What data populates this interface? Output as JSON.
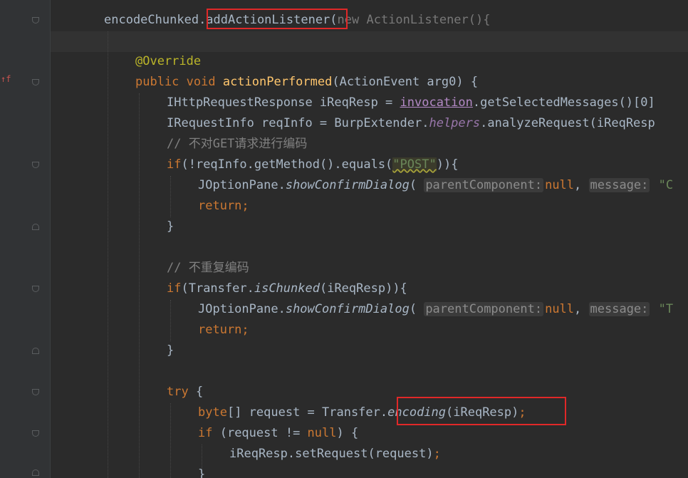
{
  "editor": {
    "lines": [
      [
        {
          "t": "encodeChunked",
          "c": "plain"
        },
        {
          "t": ".addActionListener",
          "c": "plain"
        },
        {
          "t": "(",
          "c": "plain"
        },
        {
          "t": "new ActionListener(){",
          "c": "dim"
        }
      ],
      [],
      [
        {
          "t": "@Override",
          "c": "anno"
        }
      ],
      [
        {
          "t": "public void ",
          "c": "kw"
        },
        {
          "t": "actionPerformed",
          "c": "fn"
        },
        {
          "t": "(ActionEvent arg0) {",
          "c": "plain"
        }
      ],
      [
        {
          "t": "IHttpRequestResponse iReqResp = ",
          "c": "plain"
        },
        {
          "t": "invocation",
          "c": "ifld"
        },
        {
          "t": ".getSelectedMessages()[0]",
          "c": "plain"
        }
      ],
      [
        {
          "t": "IRequestInfo reqInfo = BurpExtender.",
          "c": "plain"
        },
        {
          "t": "helpers",
          "c": "fld"
        },
        {
          "t": ".analyzeRequest(iReqResp",
          "c": "plain"
        }
      ],
      [
        {
          "t": "// 不对GET请求进行编码",
          "c": "cmt"
        }
      ],
      [
        {
          "t": "if",
          "c": "kw"
        },
        {
          "t": "(!reqInfo.getMethod().equals(",
          "c": "plain"
        },
        {
          "t": "\"POST\"",
          "c": "str"
        },
        {
          "t": ")){",
          "c": "plain"
        }
      ],
      [
        {
          "t": "JOptionPane.",
          "c": "plain"
        },
        {
          "t": "showConfirmDialog",
          "c": "sm"
        },
        {
          "t": "( ",
          "c": "plain"
        },
        {
          "t": "parentComponent:",
          "c": "hint"
        },
        {
          "t": "null",
          "c": "kw"
        },
        {
          "t": ", ",
          "c": "plain"
        },
        {
          "t": "message:",
          "c": "hint"
        },
        {
          "t": " \"C",
          "c": "strp"
        }
      ],
      [
        {
          "t": "return;",
          "c": "kw"
        }
      ],
      [
        {
          "t": "}",
          "c": "plain"
        }
      ],
      [],
      [
        {
          "t": "// 不重复编码",
          "c": "cmt"
        }
      ],
      [
        {
          "t": "if",
          "c": "kw"
        },
        {
          "t": "(Transfer.",
          "c": "plain"
        },
        {
          "t": "isChunked",
          "c": "sm"
        },
        {
          "t": "(iReqResp)){",
          "c": "plain"
        }
      ],
      [
        {
          "t": "JOptionPane.",
          "c": "plain"
        },
        {
          "t": "showConfirmDialog",
          "c": "sm"
        },
        {
          "t": "( ",
          "c": "plain"
        },
        {
          "t": "parentComponent:",
          "c": "hint"
        },
        {
          "t": "null",
          "c": "kw"
        },
        {
          "t": ", ",
          "c": "plain"
        },
        {
          "t": "message:",
          "c": "hint"
        },
        {
          "t": " \"T",
          "c": "strp"
        }
      ],
      [
        {
          "t": "return;",
          "c": "kw"
        }
      ],
      [
        {
          "t": "}",
          "c": "plain"
        }
      ],
      [],
      [
        {
          "t": "try ",
          "c": "kw"
        },
        {
          "t": "{",
          "c": "plain"
        }
      ],
      [
        {
          "t": "byte",
          "c": "kw"
        },
        {
          "t": "[] request = Transfer.",
          "c": "plain"
        },
        {
          "t": "encoding",
          "c": "sm"
        },
        {
          "t": "(iReqResp)",
          "c": "plain"
        },
        {
          "t": ";",
          "c": "kw"
        }
      ],
      [
        {
          "t": "if ",
          "c": "kw"
        },
        {
          "t": "(request != ",
          "c": "plain"
        },
        {
          "t": "null",
          "c": "kw"
        },
        {
          "t": ") {",
          "c": "plain"
        }
      ],
      [
        {
          "t": "iReqResp.setRequest(request)",
          "c": "plain"
        },
        {
          "t": ";",
          "c": "kw"
        }
      ],
      [
        {
          "t": "}",
          "c": "plain"
        }
      ]
    ]
  }
}
